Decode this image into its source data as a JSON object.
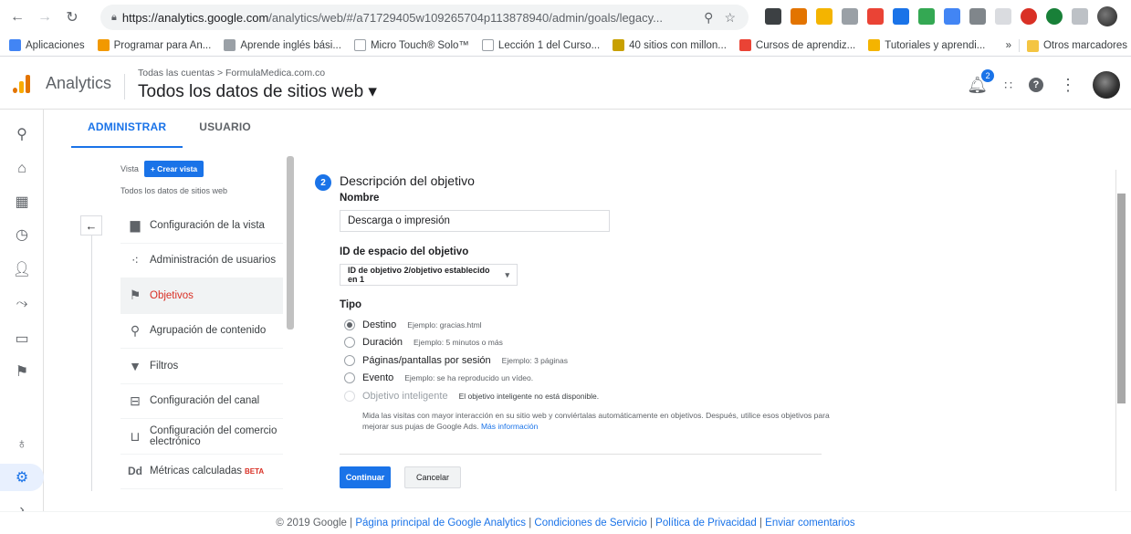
{
  "browser": {
    "url_host": "https://analytics.google.com",
    "url_path": "/analytics/web/#/a71729405w109265704p113878940/admin/goals/legacy...",
    "bookmarks": [
      {
        "label": "Aplicaciones",
        "color": "#4285f4"
      },
      {
        "label": "Programar para An...",
        "color": "#f29900"
      },
      {
        "label": "Aprende inglés bási...",
        "color": "#9aa0a6"
      },
      {
        "label": "Micro Touch® Solo™",
        "color": "#9aa0a6"
      },
      {
        "label": "Lección 1 del Curso...",
        "color": "#9aa0a6"
      },
      {
        "label": "40 sitios con millon...",
        "color": "#c8a000"
      },
      {
        "label": "Cursos de aprendiz...",
        "color": "#ea4335"
      },
      {
        "label": "Tutoriales y aprendi...",
        "color": "#f4b400"
      }
    ],
    "overflow": "»",
    "other_bookmarks": "Otros marcadores"
  },
  "header": {
    "app_name": "Analytics",
    "breadcrumb": "Todas las cuentas > FormulaMedica.com.co",
    "property": "Todos los datos de sitios web ▾",
    "notification_count": "2"
  },
  "tabs": [
    "ADMINISTRAR",
    "USUARIO"
  ],
  "admin": {
    "view_label": "Vista",
    "create_view": "+ Crear vista",
    "view_name": "Todos los datos de sitios web",
    "menu": [
      {
        "label": "Configuración de la vista",
        "icon": "document-icon",
        "glyph": "▆"
      },
      {
        "label": "Administración de usuarios",
        "icon": "users-icon",
        "glyph": "⁖"
      },
      {
        "label": "Objetivos",
        "icon": "flag-icon",
        "glyph": "⚑",
        "active": true
      },
      {
        "label": "Agrupación de contenido",
        "icon": "person-walk-icon",
        "glyph": "⚲"
      },
      {
        "label": "Filtros",
        "icon": "filter-icon",
        "glyph": "▼"
      },
      {
        "label": "Configuración del canal",
        "icon": "channel-icon",
        "glyph": "⊟"
      },
      {
        "label": "Configuración del comercio electrónico",
        "icon": "cart-icon",
        "glyph": "⊔"
      },
      {
        "label": "Métricas calculadas",
        "icon": "dd-icon",
        "glyph": "Dd",
        "beta": "BETA"
      }
    ]
  },
  "form": {
    "step": "2",
    "title": "Descripción del objetivo",
    "name_label": "Nombre",
    "name_value": "Descarga o impresión",
    "slot_label": "ID de espacio del objetivo",
    "slot_value": "ID de objetivo 2/objetivo establecido en 1",
    "type_label": "Tipo",
    "types": [
      {
        "label": "Destino",
        "example": "Ejemplo: gracias.html",
        "checked": true
      },
      {
        "label": "Duración",
        "example": "Ejemplo: 5 minutos o más"
      },
      {
        "label": "Páginas/pantallas por sesión",
        "example": "Ejemplo: 3 páginas"
      },
      {
        "label": "Evento",
        "example": "Ejemplo: se ha reproducido un vídeo."
      },
      {
        "label": "Objetivo inteligente",
        "example": "El objetivo inteligente no está disponible.",
        "disabled": true
      }
    ],
    "smart_desc": "Mida las visitas con mayor interacción en su sitio web y conviértalas automáticamente en objetivos. Después, utilice esos objetivos para mejorar sus pujas de Google Ads.",
    "more_info": "Más información",
    "continue": "Continuar",
    "cancel": "Cancelar"
  },
  "footer": {
    "copyright": "© 2019 Google |",
    "links": [
      "Página principal de Google Analytics",
      "Condiciones de Servicio",
      "Política de Privacidad",
      "Enviar comentarios"
    ]
  },
  "colors": {
    "accent": "#1a73e8",
    "active_menu": "#d93025"
  }
}
